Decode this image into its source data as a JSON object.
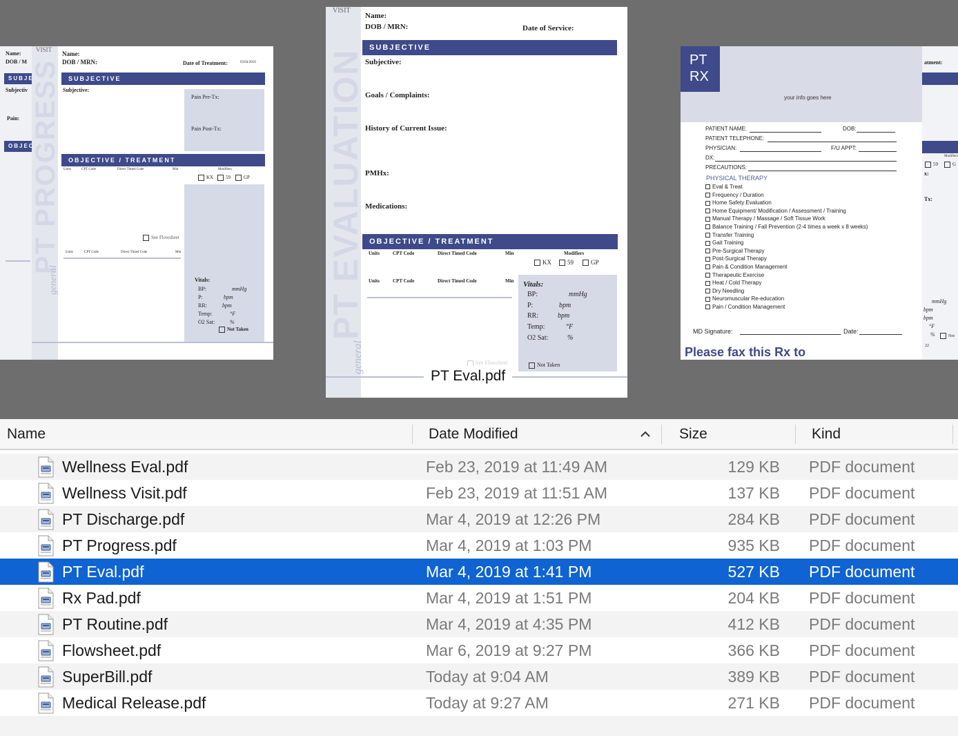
{
  "preview": {
    "caption": "PT Eval.pdf",
    "left_doc": {
      "visit": "VISIT",
      "name": "Name:",
      "dob": "DOB / MRN:",
      "date_of_treatment": "Date of Treatment:",
      "date_value": "03/04/2019",
      "subjective_band": "SUBJECTIVE",
      "subjective": "Subjective:",
      "pain_pre": "Pain Pre-Tx:",
      "pain_post": "Pain Post-Tx:",
      "objective_band": "OBJECTIVE / TREATMENT",
      "units": "Units",
      "cpt": "CPT Code",
      "direct": "Direct Timed Code",
      "min": "Min",
      "modifiers": "Modifiers",
      "kx": "KX",
      "m59": "59",
      "gp": "GP",
      "see_flowsheet": "See Flowsheet",
      "vitals": "Vitals:",
      "bp": "BP:",
      "p": "P:",
      "rr": "RR:",
      "temp": "Temp:",
      "o2": "O2 Sat:",
      "mmhg": "mmHg",
      "bpm": "bpm",
      "deg": "°F",
      "pct": "%",
      "not_taken": "Not Taken",
      "side_title": "PT PROGRESS",
      "script": "general",
      "back_name": "Name:",
      "back_dob": "DOB / M",
      "back_subj": "SUBJE",
      "back_subjective": "Subjectiv",
      "back_pain": "Pain:",
      "back_obj": "OBJEC"
    },
    "center_doc": {
      "visit": "VISIT",
      "name": "Name:",
      "dob": "DOB / MRN:",
      "date_of_service": "Date of Service:",
      "subjective_band": "SUBJECTIVE",
      "subjective": "Subjective:",
      "goals": "Goals / Complaints:",
      "history": "History of Current Issue:",
      "pmhx": "PMHx:",
      "medications": "Medications:",
      "objective_band": "OBJECTIVE / TREATMENT",
      "units": "Units",
      "cpt": "CPT Code",
      "direct": "Direct Timed Code",
      "min": "Min",
      "modifiers": "Modifiers",
      "kx": "KX",
      "m59": "59",
      "gp": "GP",
      "vitals": "Vitals:",
      "bp": "BP:",
      "p": "P:",
      "rr": "RR:",
      "temp": "Temp:",
      "o2": "O2 Sat:",
      "mmhg": "mmHg",
      "bpm": "bpm",
      "deg": "°F",
      "pct": "%",
      "not_taken": "Not Taken",
      "see_flowsheet": "See Flowsheet",
      "side_title": "PT EVALUATION",
      "script": "general"
    },
    "right_doc": {
      "logo_line1": "PT",
      "logo_line2": "RX",
      "info": "your info goes here",
      "patient_name": "PATIENT NAME:",
      "dob": "DOB:",
      "telephone": "PATIENT TELEPHONE:",
      "physician": "PHYSICIAN:",
      "fu_appt": "F/U APPT:",
      "dx": "DX:",
      "precautions": "PRECAUTIONS:",
      "section": "PHYSICAL THERAPY",
      "items": [
        "Eval & Treat",
        "Frequency / Duration",
        "Home Safety Evaluation",
        "Home Equipment/ Modification / Assessment / Training",
        "Manual Therapy / Massage / Soft Tissue Work",
        "Balance Training / Fall Prevention (2-4 times a week x 8 weeks)",
        "Transfer Training",
        "Gait Training",
        "Pre-Surgical Therapy",
        "Post-Surgical Therapy",
        "Pain & Condition Management",
        "Therapeutic Exercise",
        "Heat / Cold Therapy",
        "Dry Needling",
        "Neuromuscular Re-education",
        "Pain / Condition Management"
      ],
      "md_signature": "MD Signature:",
      "date": "Date:",
      "fax": "Please fax this Rx to",
      "back_treatment": "atment:",
      "back_tx": "Tx:",
      "back_x": "x:",
      "back_modifiers": "Modifiers",
      "back_59": "59",
      "back_g": "G",
      "back_mmhg": "mmHg",
      "back_bpm1": "bpm",
      "back_bpm2": "bpm",
      "back_deg": "°F",
      "back_pct": "%",
      "back_not": "Not",
      "back_22": "22"
    }
  },
  "columns": {
    "name": "Name",
    "date_modified": "Date Modified",
    "size": "Size",
    "kind": "Kind",
    "sort_icon": "chevron-up-icon"
  },
  "files": [
    {
      "name": "Wellness Eval.pdf",
      "date": "Feb 23, 2019 at 11:49 AM",
      "size": "129 KB",
      "kind": "PDF document",
      "selected": false
    },
    {
      "name": "Wellness Visit.pdf",
      "date": "Feb 23, 2019 at 11:51 AM",
      "size": "137 KB",
      "kind": "PDF document",
      "selected": false
    },
    {
      "name": "PT Discharge.pdf",
      "date": "Mar 4, 2019 at 12:26 PM",
      "size": "284 KB",
      "kind": "PDF document",
      "selected": false
    },
    {
      "name": "PT Progress.pdf",
      "date": "Mar 4, 2019 at 1:03 PM",
      "size": "935 KB",
      "kind": "PDF document",
      "selected": false
    },
    {
      "name": "PT Eval.pdf",
      "date": "Mar 4, 2019 at 1:41 PM",
      "size": "527 KB",
      "kind": "PDF document",
      "selected": true
    },
    {
      "name": "Rx Pad.pdf",
      "date": "Mar 4, 2019 at 1:51 PM",
      "size": "204 KB",
      "kind": "PDF document",
      "selected": false
    },
    {
      "name": "PT Routine.pdf",
      "date": "Mar 4, 2019 at 4:35 PM",
      "size": "412 KB",
      "kind": "PDF document",
      "selected": false
    },
    {
      "name": "Flowsheet.pdf",
      "date": "Mar 6, 2019 at 9:27 PM",
      "size": "366 KB",
      "kind": "PDF document",
      "selected": false
    },
    {
      "name": "SuperBill.pdf",
      "date": "Today at 9:04 AM",
      "size": "389 KB",
      "kind": "PDF document",
      "selected": false
    },
    {
      "name": "Medical Release.pdf",
      "date": "Today at 9:27 AM",
      "size": "271 KB",
      "kind": "PDF document",
      "selected": false
    }
  ],
  "colors": {
    "selection": "#0f63d2",
    "form_band": "#3e4a8a",
    "coverflow_bg": "#6e6e6e"
  }
}
